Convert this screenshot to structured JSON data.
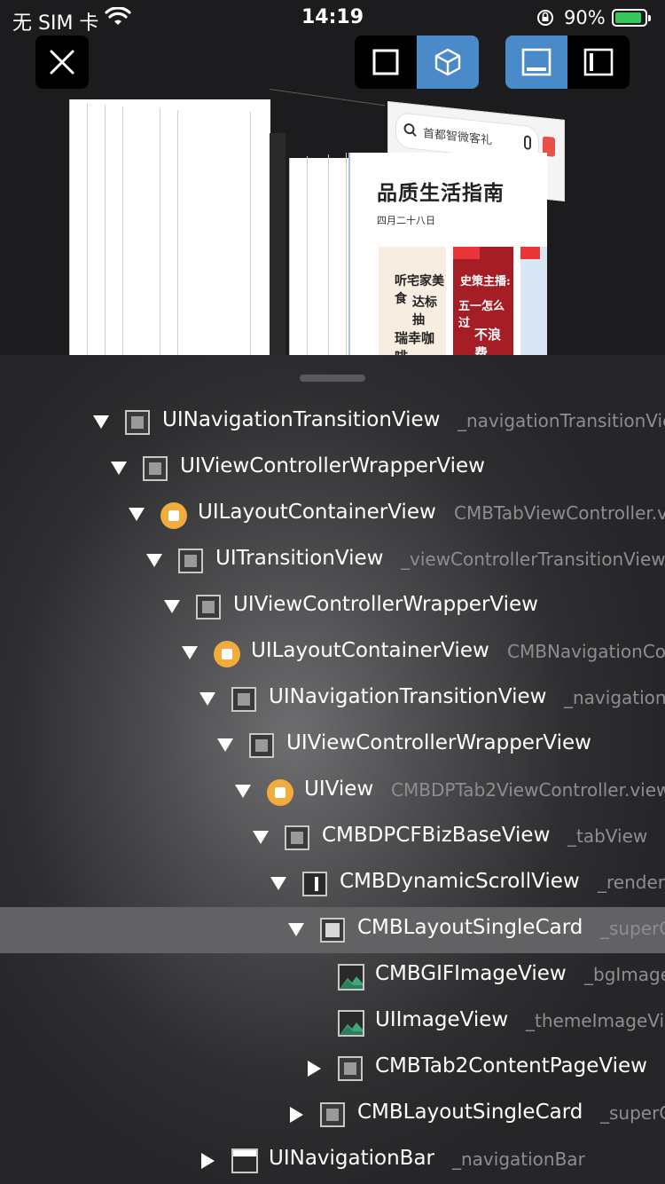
{
  "status_bar": {
    "carrier": "无 SIM 卡",
    "time": "14:19",
    "battery_percent": "90%",
    "battery_level": 0.9,
    "battery_color": "#35c759"
  },
  "toolbar": {
    "close_icon": "close-icon",
    "mode_options": [
      {
        "icon": "square-2d-icon",
        "active": false
      },
      {
        "icon": "cube-3d-icon",
        "active": true
      }
    ],
    "layout_options": [
      {
        "icon": "panel-bottom-icon",
        "active": true
      },
      {
        "icon": "panel-side-icon",
        "active": false
      }
    ],
    "accent_color": "#4a8ac9"
  },
  "preview": {
    "search_placeholder": "首都智微客礼",
    "title": "品质生活指南",
    "date": "四月二十八日",
    "tile1_line1": "听宅家美食",
    "tile1_line2": "达标抽",
    "tile1_line3": "瑞幸咖啡",
    "tile2_line1": "史策主播:",
    "tile2_line2": "五一怎么过",
    "tile2_line3": "不浪费"
  },
  "hierarchy": {
    "rows": [
      {
        "name": "UINavigationTransitionView",
        "sub": "_navigationTransitionView",
        "icon": "view-box-icon",
        "expanded": true
      },
      {
        "name": "UIViewControllerWrapperView",
        "sub": "",
        "icon": "view-box-icon",
        "expanded": true
      },
      {
        "name": "UILayoutContainerView",
        "sub": "CMBTabViewController.view",
        "icon": "view-controller-icon",
        "expanded": true
      },
      {
        "name": "UITransitionView",
        "sub": "_viewControllerTransitionView",
        "icon": "view-box-icon",
        "expanded": true
      },
      {
        "name": "UIViewControllerWrapperView",
        "sub": "",
        "icon": "view-box-icon",
        "expanded": true
      },
      {
        "name": "UILayoutContainerView",
        "sub": "CMBNavigationController.view",
        "icon": "view-controller-icon",
        "expanded": true
      },
      {
        "name": "UINavigationTransitionView",
        "sub": "_navigationTransitionView",
        "icon": "view-box-icon",
        "expanded": true
      },
      {
        "name": "UIViewControllerWrapperView",
        "sub": "",
        "icon": "view-box-icon",
        "expanded": true
      },
      {
        "name": "UIView",
        "sub": "CMBDPTab2ViewController.view",
        "icon": "view-controller-icon",
        "expanded": true
      },
      {
        "name": "CMBDPCFBizBaseView",
        "sub": "_tabView",
        "icon": "view-box-icon",
        "expanded": true
      },
      {
        "name": "CMBDynamicScrollView",
        "sub": "_renderView",
        "icon": "scroll-view-icon",
        "expanded": true
      },
      {
        "name": "CMBLayoutSingleCard",
        "sub": "_superCard",
        "icon": "card-icon",
        "expanded": true,
        "selected": true
      },
      {
        "name": "CMBGIFImageView",
        "sub": "_bgImageView",
        "icon": "image-icon",
        "leaf": true
      },
      {
        "name": "UIImageView",
        "sub": "_themeImageView",
        "icon": "image-icon",
        "leaf": true
      },
      {
        "name": "CMBTab2ContentPageView",
        "sub": "",
        "icon": "view-box-icon",
        "expanded": false
      },
      {
        "name": "CMBLayoutSingleCard",
        "sub": "_superCard",
        "icon": "view-box-icon",
        "expanded": false
      },
      {
        "name": "UINavigationBar",
        "sub": "_navigationBar",
        "icon": "navigation-bar-icon",
        "expanded": false
      }
    ]
  }
}
